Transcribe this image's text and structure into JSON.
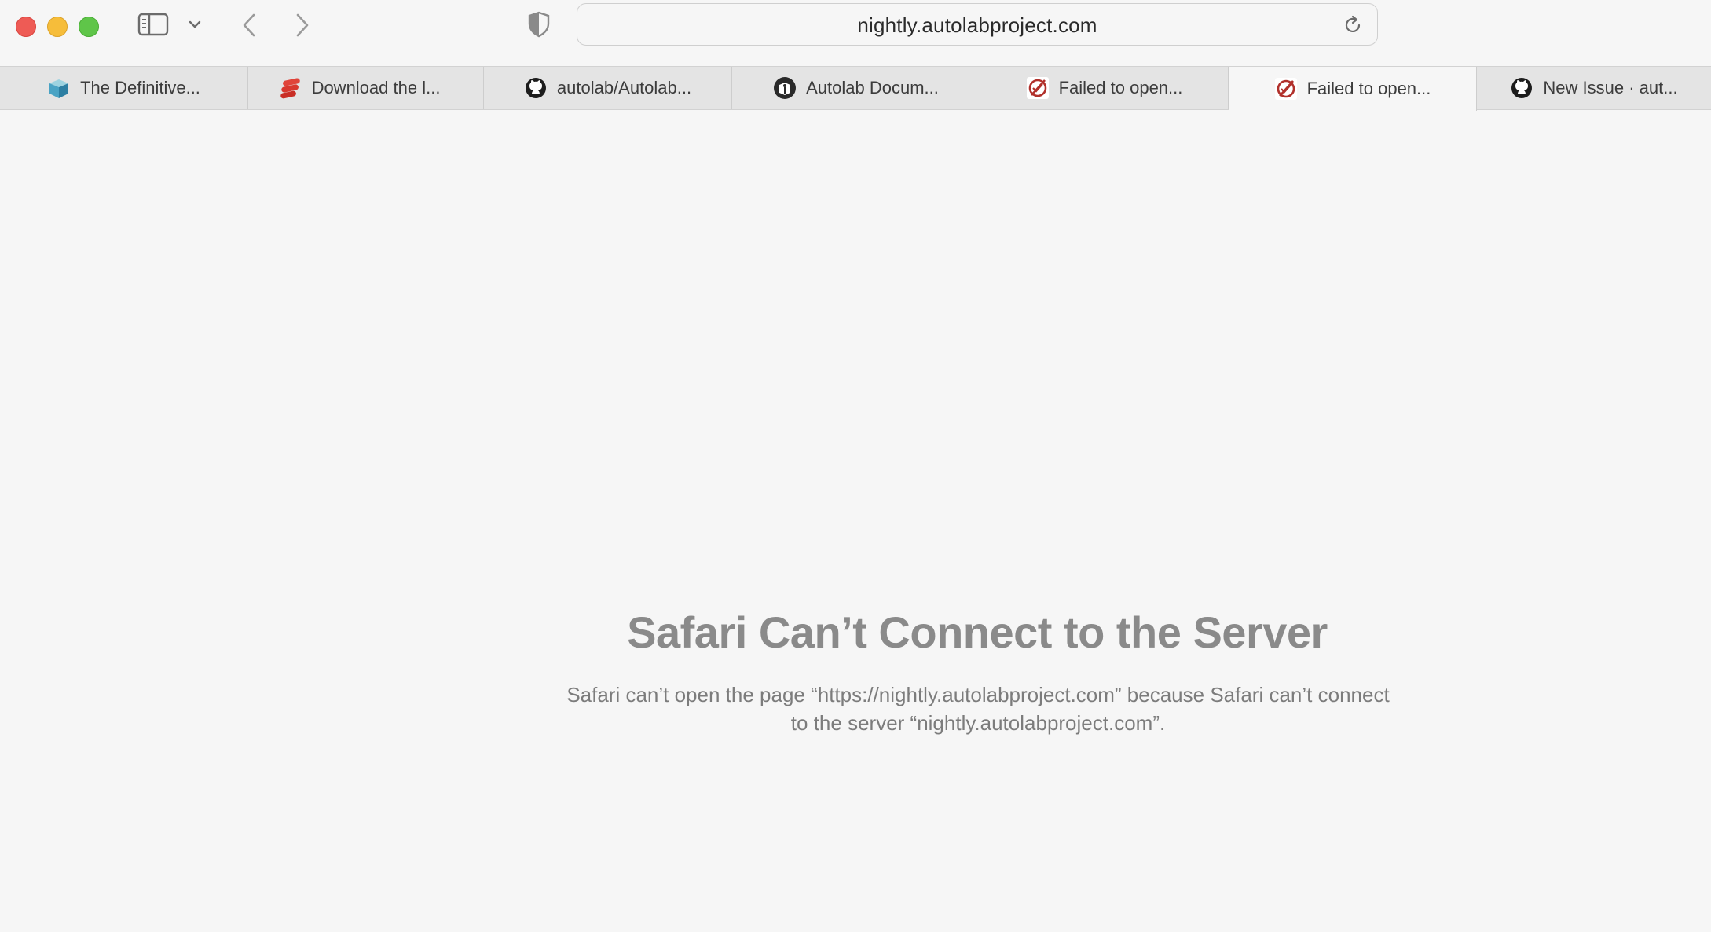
{
  "window": {
    "address": "nightly.autolabproject.com"
  },
  "toolbar": {
    "icons": [
      "close-button",
      "minimize-button",
      "zoom-button",
      "sidebar-icon",
      "chevron-down-icon",
      "back-arrow-icon",
      "forward-arrow-icon",
      "privacy-shield-icon",
      "reload-icon"
    ]
  },
  "tabs": [
    {
      "label": "The Definitive...",
      "icon": "book-cube-icon",
      "active": false
    },
    {
      "label": "Download the l...",
      "icon": "download-stack-icon",
      "active": false
    },
    {
      "label": "autolab/Autolab...",
      "icon": "github-icon",
      "active": false
    },
    {
      "label": "Autolab Docum...",
      "icon": "docs-icon",
      "active": false
    },
    {
      "label": "Failed to open...",
      "icon": "failed-page-icon",
      "active": false
    },
    {
      "label": "Failed to open...",
      "icon": "failed-page-icon",
      "active": true
    },
    {
      "label": "New Issue · aut...",
      "icon": "github-icon",
      "active": false
    }
  ],
  "error": {
    "title": "Safari Can’t Connect to the Server",
    "message": "Safari can’t open the page “https://nightly.autolabproject.com” because Safari can’t connect to the server “nightly.autolabproject.com”."
  },
  "colors": {
    "background": "#f6f6f6",
    "tab_bar": "#e4e4e4",
    "close": "#ee5b55",
    "minimize": "#f6bd3a",
    "zoom": "#5fc549",
    "title_text": "#8a8a8a"
  }
}
